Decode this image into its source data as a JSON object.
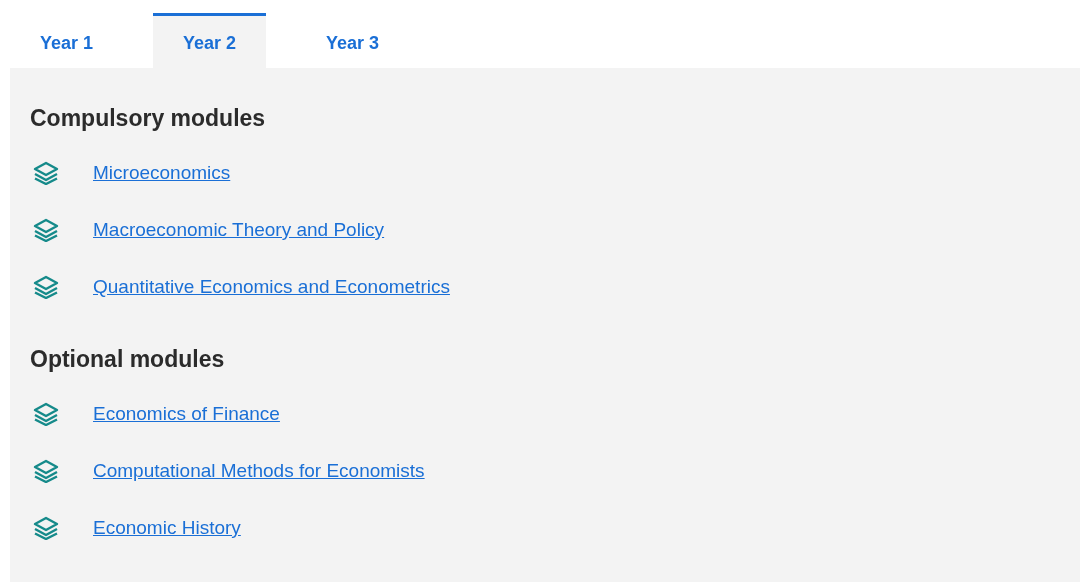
{
  "tabs": [
    {
      "label": "Year 1",
      "selected": false
    },
    {
      "label": "Year 2",
      "selected": true
    },
    {
      "label": "Year 3",
      "selected": false
    }
  ],
  "sections": [
    {
      "heading": "Compulsory modules",
      "modules": [
        "Microeconomics",
        "Macroeconomic Theory and Policy",
        "Quantitative Economics and Econometrics"
      ]
    },
    {
      "heading": "Optional modules",
      "modules": [
        "Economics of Finance",
        "Computational Methods for Economists",
        "Economic History"
      ]
    }
  ]
}
